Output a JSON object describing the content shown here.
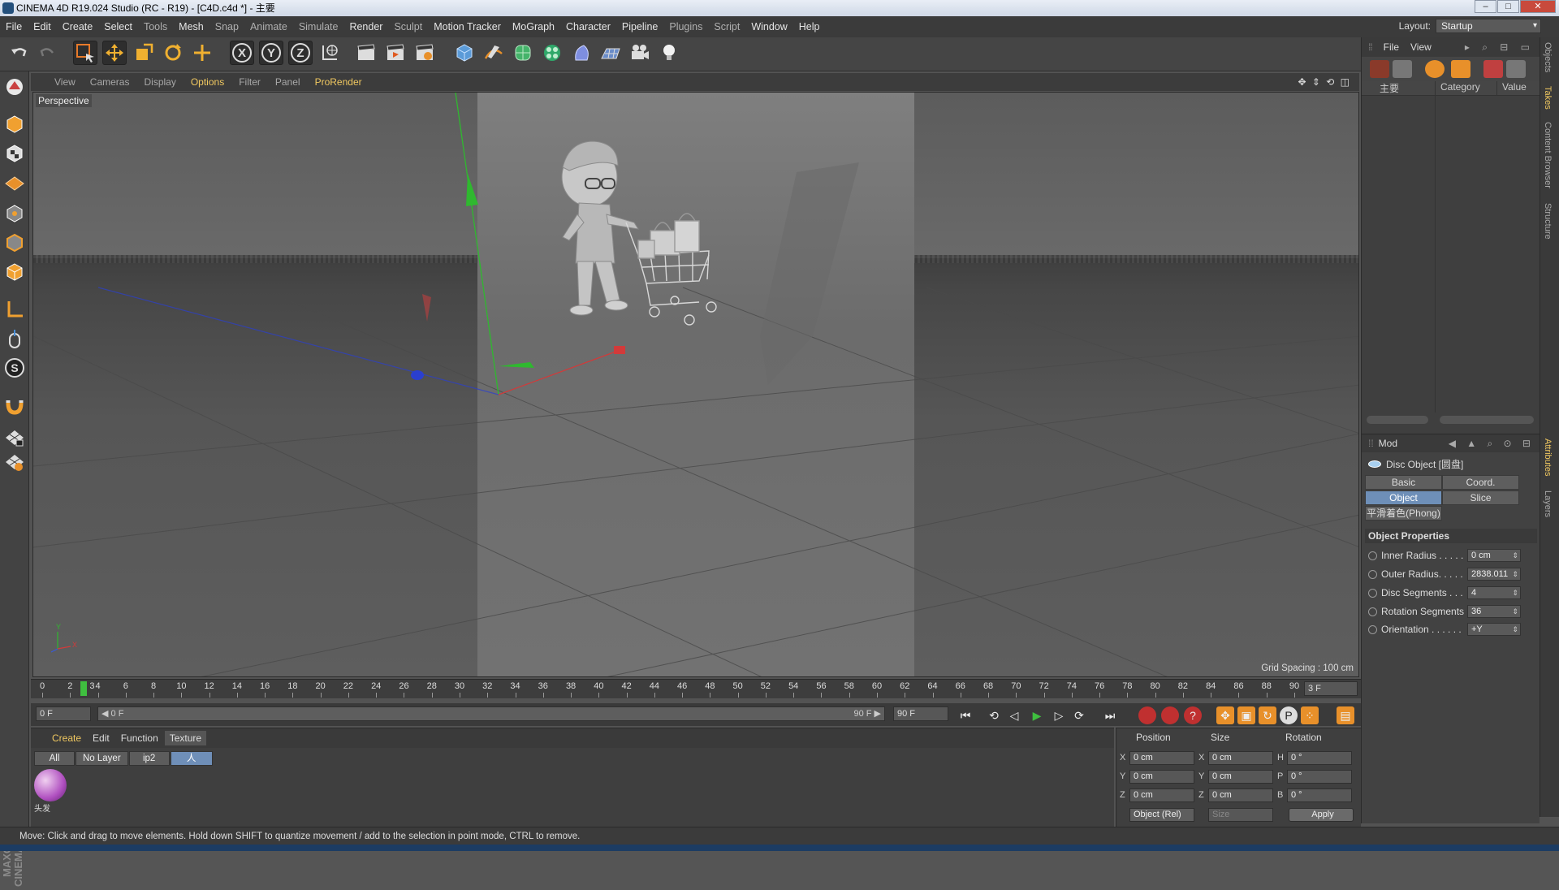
{
  "window": {
    "title": "CINEMA 4D R19.024 Studio (RC - R19) - [C4D.c4d *] - 主要",
    "minimize": "–",
    "maximize": "□",
    "close": "✕"
  },
  "menu": [
    "File",
    "Edit",
    "Create",
    "Select",
    "Tools",
    "Mesh",
    "Snap",
    "Animate",
    "Simulate",
    "Render",
    "Sculpt",
    "Motion Tracker",
    "MoGraph",
    "Character",
    "Pipeline",
    "Plugins",
    "Script",
    "Window",
    "Help"
  ],
  "layout": {
    "label": "Layout:",
    "value": "Startup"
  },
  "toolbar": {
    "x_label": "X",
    "y_label": "Y",
    "z_label": "Z"
  },
  "viewport_menu": [
    "View",
    "Cameras",
    "Display",
    "Options",
    "Filter",
    "Panel",
    "ProRender"
  ],
  "viewport": {
    "label": "Perspective",
    "grid_spacing": "Grid Spacing : 100 cm",
    "axis_y": "Y",
    "axis_x": "X",
    "nav_icons": "✥ ⇕ ⟲ ◫"
  },
  "object_manager": {
    "menu": [
      "File",
      "View"
    ],
    "column_name": "主要",
    "column_category": "Category",
    "column_value": "Value"
  },
  "side_tabs": [
    "Objects",
    "Takes",
    "Content Browser",
    "Structure",
    "Attributes",
    "Layers"
  ],
  "attributes": {
    "mode": "Mod",
    "object_title": "Disc Object [圆盘]",
    "tabs": [
      "Basic",
      "Coord.",
      "Object",
      "Slice"
    ],
    "phong_tab": "平滑着色(Phong)",
    "section": "Object Properties",
    "props": [
      {
        "label": "Inner Radius . . . . .",
        "value": "0 cm"
      },
      {
        "label": "Outer Radius. . . . .",
        "value": "2838.011"
      },
      {
        "label": "Disc Segments . . .",
        "value": "4"
      },
      {
        "label": "Rotation Segments",
        "value": "36"
      },
      {
        "label": "Orientation . . . . . .",
        "value": "+Y"
      }
    ]
  },
  "timeline": {
    "ticks": [
      "0",
      "2",
      "4",
      "6",
      "8",
      "10",
      "12",
      "14",
      "16",
      "18",
      "20",
      "22",
      "24",
      "26",
      "28",
      "30",
      "32",
      "34",
      "36",
      "38",
      "40",
      "42",
      "44",
      "46",
      "48",
      "50",
      "52",
      "54",
      "56",
      "58",
      "60",
      "62",
      "64",
      "66",
      "68",
      "70",
      "72",
      "74",
      "76",
      "78",
      "80",
      "82",
      "84",
      "86",
      "88",
      "90"
    ],
    "current_frame": 3,
    "current_label": "3",
    "end_field": "3 F"
  },
  "playback": {
    "start": "0 F",
    "range_start": "◀ 0 F",
    "range_end": "90 F ▶",
    "end": "90 F"
  },
  "material_manager": {
    "menu": [
      "Create",
      "Edit",
      "Function",
      "Texture"
    ],
    "tabs": [
      "All",
      "No Layer",
      "ip2",
      "人"
    ],
    "material_name": "头发"
  },
  "coordinates": {
    "headers": [
      "Position",
      "Size",
      "Rotation"
    ],
    "rows": [
      {
        "pl": "X",
        "pv": "0 cm",
        "sl": "X",
        "sv": "0 cm",
        "rl": "H",
        "rv": "0 °"
      },
      {
        "pl": "Y",
        "pv": "0 cm",
        "sl": "Y",
        "sv": "0 cm",
        "rl": "P",
        "rv": "0 °"
      },
      {
        "pl": "Z",
        "pv": "0 cm",
        "sl": "Z",
        "sv": "0 cm",
        "rl": "B",
        "rv": "0 °"
      }
    ],
    "mode": "Object (Rel)",
    "size_mode": "Size",
    "apply": "Apply"
  },
  "status": "Move: Click and drag to move elements. Hold down SHIFT to quantize movement / add to the selection in point mode, CTRL to remove.",
  "colors": {
    "accent": "#f0c860",
    "selected": "#6e8fb8",
    "play_green": "#3fbf3f",
    "axis_green": "#2fb82f",
    "axis_red": "#d23a3a",
    "axis_blue": "#2a3fd0"
  }
}
